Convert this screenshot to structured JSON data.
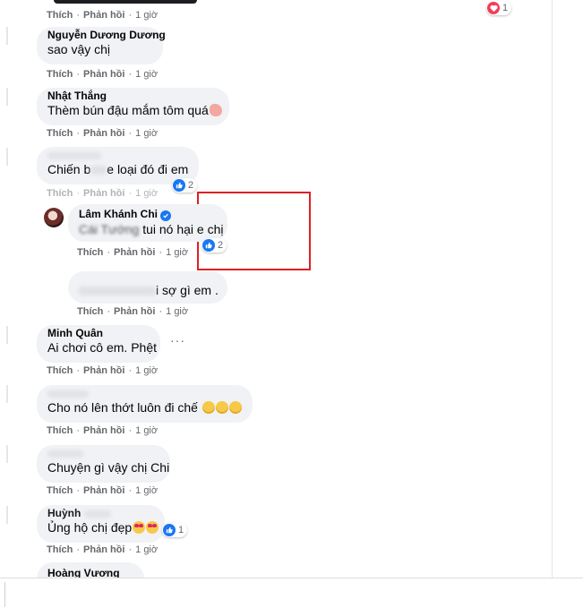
{
  "top_reaction": {
    "count": "1"
  },
  "action_like": "Thích",
  "action_reply": "Phản hồi",
  "time": "1 giờ",
  "comments": [
    {
      "author": "Nguyễn Dương Dương",
      "text": "sao vậy chị"
    },
    {
      "author": "Nhật Thắng",
      "text": "Thèm bún đậu mắm tôm quá"
    },
    {
      "author": "",
      "text_before": "Chiến b",
      "text_after": "e loại đó đi em",
      "reactions": "2"
    },
    {
      "author": "Lâm Khánh Chi",
      "verified": true,
      "text_blur": "Cái Tướng",
      "text": "tui nó hại e chị",
      "reactions": "2"
    },
    {
      "author": "",
      "text_after": "i sợ gì em ."
    },
    {
      "author": "Minh Quân",
      "text": "Ai chơi cô em. Phệt"
    },
    {
      "author": "",
      "text": "Cho nó lên thớt luôn đi chế"
    },
    {
      "author": "",
      "text": "Chuyện gì vậy chị Chi"
    },
    {
      "author": "Huỳnh",
      "text": "Ủng hộ chị đẹp",
      "reactions": "1"
    },
    {
      "author": "Hoàng Vương",
      "text": ""
    }
  ],
  "colors": {
    "like_blue": "#1877f2",
    "highlight_red": "#e02020",
    "bubble": "#f0f2f5"
  },
  "icons": [
    "heart-icon",
    "like-icon",
    "verified-icon",
    "more-icon",
    "grin-emoji",
    "heart-eyes-emoji",
    "shrimp-emoji"
  ]
}
